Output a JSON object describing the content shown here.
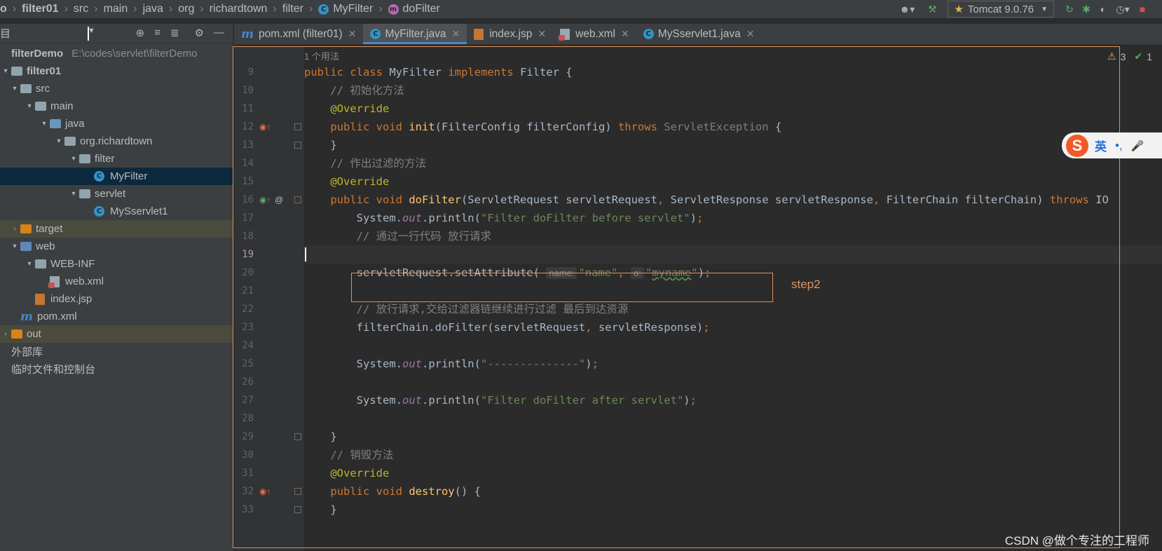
{
  "breadcrumb": [
    {
      "label": "o",
      "bold": true
    },
    {
      "label": "filter01",
      "bold": true
    },
    {
      "label": "src"
    },
    {
      "label": "main"
    },
    {
      "label": "java"
    },
    {
      "label": "org"
    },
    {
      "label": "richardtown"
    },
    {
      "label": "filter"
    },
    {
      "label": "MyFilter",
      "icon": "C"
    },
    {
      "label": "doFilter",
      "icon": "m"
    }
  ],
  "toolbar": {
    "run_config": "Tomcat 9.0.76"
  },
  "project": {
    "header_label": "目",
    "tree": [
      {
        "label": "filterDemo",
        "path": "E:\\codes\\servlet\\filterDemo",
        "indent": 0,
        "bold": true,
        "arrow": "",
        "kind": "none"
      },
      {
        "label": "filter01",
        "indent": 0,
        "bold": true,
        "arrow": "▾",
        "kind": "folder"
      },
      {
        "label": "src",
        "indent": 1,
        "arrow": "▾",
        "kind": "folder"
      },
      {
        "label": "main",
        "indent": 2,
        "arrow": "▾",
        "kind": "folder"
      },
      {
        "label": "java",
        "indent": 3,
        "arrow": "▾",
        "kind": "folder-blue"
      },
      {
        "label": "org.richardtown",
        "indent": 4,
        "arrow": "▾",
        "kind": "folder-pkg"
      },
      {
        "label": "filter",
        "indent": 5,
        "arrow": "▾",
        "kind": "folder-pkg"
      },
      {
        "label": "MyFilter",
        "indent": 6,
        "arrow": "",
        "kind": "class",
        "selected": true
      },
      {
        "label": "servlet",
        "indent": 5,
        "arrow": "▾",
        "kind": "folder-pkg"
      },
      {
        "label": "MySservlet1",
        "indent": 6,
        "arrow": "",
        "kind": "class"
      },
      {
        "label": "target",
        "indent": 1,
        "arrow": "›",
        "kind": "folder-orange",
        "marked": true
      },
      {
        "label": "web",
        "indent": 1,
        "arrow": "▾",
        "kind": "folder-web"
      },
      {
        "label": "WEB-INF",
        "indent": 2,
        "arrow": "▾",
        "kind": "folder"
      },
      {
        "label": "web.xml",
        "indent": 3,
        "arrow": "",
        "kind": "xml"
      },
      {
        "label": "index.jsp",
        "indent": 2,
        "arrow": "",
        "kind": "jsp"
      },
      {
        "label": "pom.xml",
        "indent": 1,
        "arrow": "",
        "kind": "maven"
      },
      {
        "label": "out",
        "indent": 0,
        "arrow": "›",
        "kind": "folder-orange",
        "marked": true
      },
      {
        "label": "外部库",
        "indent": 0,
        "arrow": "",
        "kind": "none"
      },
      {
        "label": "临时文件和控制台",
        "indent": 0,
        "arrow": "",
        "kind": "none"
      }
    ]
  },
  "tabs": [
    {
      "label": "pom.xml (filter01)",
      "icon": "m"
    },
    {
      "label": "MyFilter.java",
      "icon": "C",
      "active": true
    },
    {
      "label": "index.jsp",
      "icon": "jsp"
    },
    {
      "label": "web.xml",
      "icon": "xml"
    },
    {
      "label": "MySservlet1.java",
      "icon": "C"
    }
  ],
  "editor": {
    "usage_hint": "1 个用法",
    "warnings": "3",
    "checks": "1",
    "current_line": 19,
    "lines": [
      {
        "n": 9,
        "html": "<span class='kw'>public class </span>MyFilter <span class='kw'>implements </span>Filter {"
      },
      {
        "n": 10,
        "html": "    <span class='cm'>// 初始化方法</span>"
      },
      {
        "n": 11,
        "html": "    <span class='ann'>@Override</span>"
      },
      {
        "n": 12,
        "html": "    <span class='kw'>public void </span><span class='fn'>init</span>(FilterConfig filterConfig) <span class='kw'>throws </span><span class='gray'>ServletException</span> {"
      },
      {
        "n": 13,
        "html": "    }"
      },
      {
        "n": 14,
        "html": "    <span class='cm'>// 作出过滤的方法</span>"
      },
      {
        "n": 15,
        "html": "    <span class='ann'>@Override</span>"
      },
      {
        "n": 16,
        "html": "    <span class='kw'>public void </span><span class='fn'>doFilter</span>(ServletRequest servletRequest<span class='kw'>, </span>ServletResponse servletResponse<span class='kw'>, </span>FilterChain filterChain) <span class='kw'>throws </span>IO"
      },
      {
        "n": 17,
        "html": "        System.<span class='st'>out</span>.println(<span class='str'>\"Filter doFilter before servlet\"</span>)<span class='kw'>;</span>"
      },
      {
        "n": 18,
        "html": "        <span class='cm'>// 通过一行代码 放行请求</span>"
      },
      {
        "n": 19,
        "html": ""
      },
      {
        "n": 20,
        "html": "        servletRequest.setAttribute( <span class='hint'>name:</span><span class='str'>\"name\"</span><span class='kw'>, </span><span class='hint'>o:</span><span class='str'>\"<span class='typo'>myname</span>\"</span>)<span class='kw'>;</span>"
      },
      {
        "n": 21,
        "html": ""
      },
      {
        "n": 22,
        "html": "        <span class='cm'>// 放行请求,交给过滤器链继续进行过滤 最后到达资源</span>"
      },
      {
        "n": 23,
        "html": "        filterChain.doFilter(servletRequest<span class='kw'>, </span>servletResponse)<span class='kw'>;</span>"
      },
      {
        "n": 24,
        "html": ""
      },
      {
        "n": 25,
        "html": "        System.<span class='st'>out</span>.println(<span class='str'>\"--------------\"</span>)<span class='kw'>;</span>"
      },
      {
        "n": 26,
        "html": ""
      },
      {
        "n": 27,
        "html": "        System.<span class='st'>out</span>.println(<span class='str'>\"Filter doFilter after servlet\"</span>)<span class='kw'>;</span>"
      },
      {
        "n": 28,
        "html": ""
      },
      {
        "n": 29,
        "html": "    }"
      },
      {
        "n": 30,
        "html": "    <span class='cm'>// 销毁方法</span>"
      },
      {
        "n": 31,
        "html": "    <span class='ann'>@Override</span>"
      },
      {
        "n": 32,
        "html": "    <span class='kw'>public void </span><span class='fn'>destroy</span>() {"
      },
      {
        "n": 33,
        "html": "    }"
      }
    ]
  },
  "annotation": {
    "step_label": "step2"
  },
  "ime": {
    "logo": "S",
    "mode": "英",
    "punct": "•,"
  },
  "watermark": "CSDN @做个专注的工程师"
}
